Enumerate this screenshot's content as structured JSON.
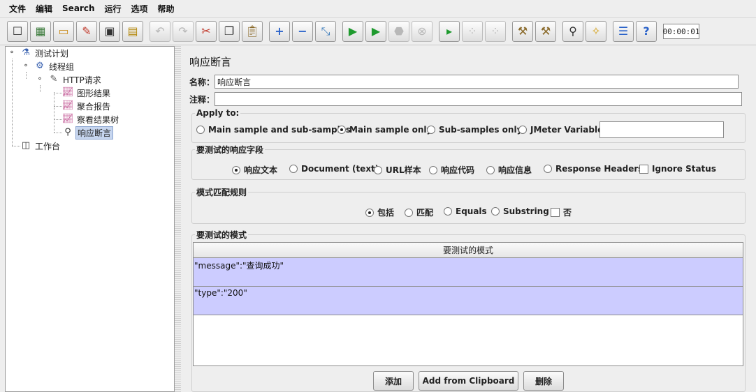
{
  "menu": [
    "文件",
    "编辑",
    "Search",
    "运行",
    "选项",
    "帮助"
  ],
  "toolbar": {
    "timer": "00:00:01",
    "icons": [
      "new-icon",
      "templates-icon",
      "open-icon",
      "close-icon",
      "save-icon",
      "save-as-icon",
      "undo-icon",
      "redo-icon",
      "cut-icon",
      "copy-icon",
      "paste-icon",
      "expand-icon",
      "collapse-icon",
      "toggle-icon",
      "start-icon",
      "start-no-pause-icon",
      "stop-icon",
      "shutdown-icon",
      "remote-start-icon",
      "remote-stop-icon",
      "remote-shutdown-icon",
      "clear-icon",
      "clear-all-icon",
      "search-icon",
      "reset-search-icon",
      "function-helper-icon",
      "help-icon"
    ]
  },
  "tree": {
    "test_plan": "测试计划",
    "thread_group": "线程组",
    "http_request": "HTTP请求",
    "graph_results": "图形结果",
    "aggregate_report": "聚合报告",
    "view_results_tree": "察看结果树",
    "response_assertion": "响应断言",
    "workbench": "工作台"
  },
  "panel": {
    "title": "响应断言",
    "name_label": "名称：",
    "name_value": "响应断言",
    "comment_label": "注释："
  },
  "apply_to": {
    "legend": "Apply to:",
    "options": [
      "Main sample and sub-samples",
      "Main sample only",
      "Sub-samples only",
      "JMeter Variable"
    ],
    "selected": 1
  },
  "response_field": {
    "legend": "要测试的响应字段",
    "options": [
      "响应文本",
      "Document (text)",
      "URL样本",
      "响应代码",
      "响应信息",
      "Response Headers"
    ],
    "selected": 0,
    "ignore_status": "Ignore Status"
  },
  "pattern_rules": {
    "legend": "模式匹配规则",
    "options": [
      "包括",
      "匹配",
      "Equals",
      "Substring"
    ],
    "selected": 0,
    "not_label": "否"
  },
  "patterns": {
    "legend": "要测试的模式",
    "header": "要测试的模式",
    "rows": [
      "\"message\":\"查询成功\"",
      "\"type\":\"200\""
    ]
  },
  "buttons": {
    "add": "添加",
    "add_clipboard": "Add from Clipboard",
    "delete": "删除"
  }
}
